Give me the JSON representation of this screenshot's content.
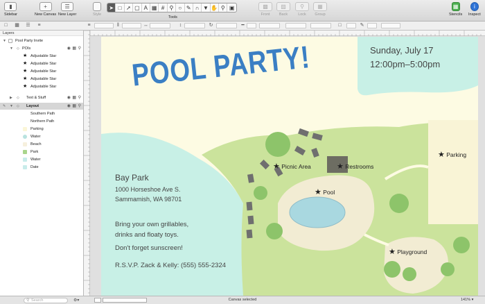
{
  "toolbar": {
    "sidebar_label": "Sidebar",
    "new_canvas_label": "New Canvas",
    "new_layer_label": "New Layer",
    "style_label": "Style",
    "tools_label": "Tools",
    "front_label": "Front",
    "back_label": "Back",
    "lock_label": "Lock",
    "group_label": "Group",
    "stencils_label": "Stencils",
    "inspect_label": "Inspect"
  },
  "sidebar": {
    "section_label": "Layers",
    "canvas_name": "Pool Party Invite",
    "pois_layer": "POIs",
    "stars": [
      "Adjustable Star",
      "Adjustable Star",
      "Adjustable Star",
      "Adjustable Star",
      "Adjustable Star"
    ],
    "text_layer": "Text & Stuff",
    "layout_layer": "Layout",
    "layout_items": [
      "Southern Path",
      "Northern Path",
      "Parking",
      "Water",
      "Beach",
      "Park",
      "Water",
      "Date"
    ],
    "swatch_colors": [
      "#ffffff",
      "#ffffff",
      "#fbf6d7",
      "#b9e3e0",
      "#f6f0dd",
      "#a9d58c",
      "#c8ecea",
      "#c8ecea"
    ]
  },
  "canvas": {
    "headline": "POOL PARTY!",
    "date": "Sunday, July 17",
    "time": "12:00pm–5:00pm",
    "venue": "Bay Park",
    "address_line1": "1000 Horseshoe Ave S.",
    "address_line2": "Sammamish, WA 98701",
    "bring_line1": "Bring your own grillables,",
    "bring_line2": "drinks and floaty toys.",
    "sunscreen": "Don't forget sunscreen!",
    "rsvp": "R.S.V.P. Zack & Kelly: (555) 555-2324",
    "map_labels": {
      "picnic": "Picnic Area",
      "restrooms": "Restrooms",
      "pool": "Pool",
      "parking": "Parking",
      "playground": "Playground"
    }
  },
  "status": {
    "search_placeholder": "Search",
    "message": "Canvas selected",
    "zoom": "141%"
  },
  "colors": {
    "headline": "#3b7fc4",
    "page_bg": "#fdfbe3",
    "water": "#c8f0e6",
    "park": "#cbe39c",
    "beach": "#f2ecd3"
  }
}
